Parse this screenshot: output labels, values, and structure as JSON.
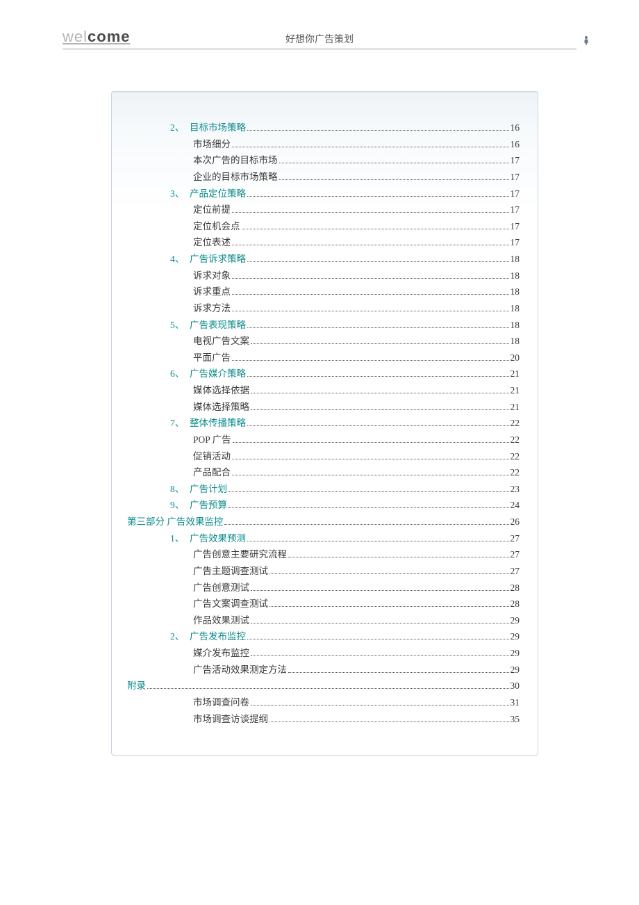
{
  "header": {
    "logo_prefix": "wel",
    "logo_suffix": "come",
    "title": "好想你广告策划"
  },
  "toc": [
    {
      "level": 1,
      "num": "2、",
      "label": "目标市场策略",
      "link": true,
      "page": "16"
    },
    {
      "level": 2,
      "label": "市场细分",
      "page": "16"
    },
    {
      "level": 2,
      "label": "本次广告的目标市场",
      "page": "17"
    },
    {
      "level": 2,
      "label": "企业的目标市场策略",
      "page": "17"
    },
    {
      "level": 1,
      "num": "3、",
      "label": "产品定位策略",
      "link": true,
      "page": "17"
    },
    {
      "level": 2,
      "label": "定位前提",
      "page": "17"
    },
    {
      "level": 2,
      "label": "定位机会点",
      "page": "17"
    },
    {
      "level": 2,
      "label": "定位表述",
      "page": "17"
    },
    {
      "level": 1,
      "num": "4、",
      "label": "广告诉求策略",
      "link": true,
      "page": "18"
    },
    {
      "level": 2,
      "label": "诉求对象",
      "page": "18"
    },
    {
      "level": 2,
      "label": "诉求重点",
      "page": "18"
    },
    {
      "level": 2,
      "label": "诉求方法",
      "page": "18"
    },
    {
      "level": 1,
      "num": "5、",
      "label": "广告表现策略",
      "link": true,
      "page": "18"
    },
    {
      "level": 2,
      "label": "电视广告文案",
      "page": "18"
    },
    {
      "level": 2,
      "label": "平面广告",
      "page": "20"
    },
    {
      "level": 1,
      "num": "6、",
      "label": "广告媒介策略",
      "link": true,
      "page": "21"
    },
    {
      "level": 2,
      "label": "媒体选择依据",
      "page": "21"
    },
    {
      "level": 2,
      "label": "媒体选择策略",
      "page": "21"
    },
    {
      "level": 1,
      "num": "7、",
      "label": "整体传播策略",
      "link": true,
      "page": "22"
    },
    {
      "level": 2,
      "label": "POP 广告",
      "page": "22"
    },
    {
      "level": 2,
      "label": "促销活动",
      "page": "22"
    },
    {
      "level": 2,
      "label": "产品配合",
      "page": "22"
    },
    {
      "level": 1,
      "num": "8、",
      "label": "广告计划",
      "link": true,
      "page": "23"
    },
    {
      "level": 1,
      "num": "9、",
      "label": "广告预算",
      "link": true,
      "page": "24"
    },
    {
      "level": 0,
      "label": "第三部分 广告效果监控",
      "link": true,
      "page": "26"
    },
    {
      "level": 1,
      "num": "1、",
      "label": "广告效果预测",
      "link": true,
      "page": "27"
    },
    {
      "level": 2,
      "label": "广告创意主要研究流程",
      "page": "27"
    },
    {
      "level": 2,
      "label": "广告主题调查测试",
      "page": "27"
    },
    {
      "level": 2,
      "label": "广告创意测试",
      "page": "28"
    },
    {
      "level": 2,
      "label": "广告文案调查测试",
      "page": "28"
    },
    {
      "level": 2,
      "label": "作品效果测试",
      "page": "29"
    },
    {
      "level": 1,
      "num": "2、",
      "label": "广告发布监控",
      "link": true,
      "page": "29"
    },
    {
      "level": 2,
      "label": "媒介发布监控",
      "page": "29"
    },
    {
      "level": 2,
      "label": "广告活动效果测定方法",
      "page": "29"
    },
    {
      "level": 0,
      "label": "附录",
      "link": true,
      "page": "30"
    },
    {
      "level": 2,
      "label": "市场调查问卷",
      "page": "31"
    },
    {
      "level": 2,
      "label": "市场调查访谈提纲",
      "page": "35"
    }
  ]
}
